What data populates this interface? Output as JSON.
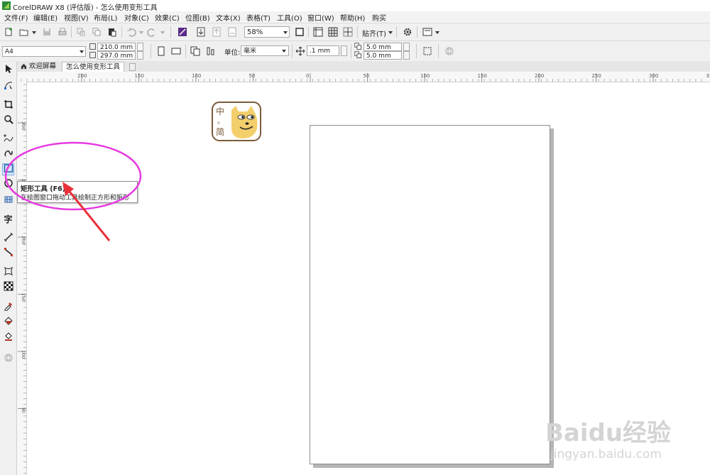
{
  "window": {
    "title": "CorelDRAW X8 (评估版) - 怎么使用变形工具"
  },
  "menu": [
    "文件(F)",
    "编辑(E)",
    "视图(V)",
    "布局(L)",
    "对象(C)",
    "效果(C)",
    "位图(B)",
    "文本(X)",
    "表格(T)",
    "工具(O)",
    "窗口(W)",
    "帮助(H)",
    "购买"
  ],
  "toolbar": {
    "zoom": "58%",
    "snap": "贴齐(T)"
  },
  "property_bar": {
    "page_size": "A4",
    "width": "210.0 mm",
    "height": "297.0 mm",
    "units_label": "单位:",
    "units": "毫米",
    "nudge": ".1 mm",
    "dup_x": "5.0 mm",
    "dup_y": "5.0 mm"
  },
  "tabs": {
    "welcome": "欢迎屏幕",
    "document": "怎么使用变形工具"
  },
  "ruler": {
    "h_labels": [
      "200",
      "150",
      "100",
      "50",
      "0",
      "50",
      "100",
      "150",
      "200",
      "250",
      "300",
      "35"
    ],
    "v_labels": [
      "300",
      "250",
      "200",
      "150",
      "100",
      "50"
    ]
  },
  "toolbox": {
    "text_tool_glyph": "字",
    "active_tool": "rectangle"
  },
  "tooltip": {
    "title": "矩形工具 (F6)",
    "desc": "在绘图窗口拖动工具绘制正方形和矩形"
  },
  "sticker": {
    "chars": [
      "中",
      "。",
      "简"
    ]
  },
  "watermark": {
    "logo": "Baidu经验",
    "url": "jingyan.baidu.com"
  },
  "colors": {
    "annotation": "#e63adf",
    "arrow": "#e8323a",
    "active_tool": "#d6e8fb"
  }
}
